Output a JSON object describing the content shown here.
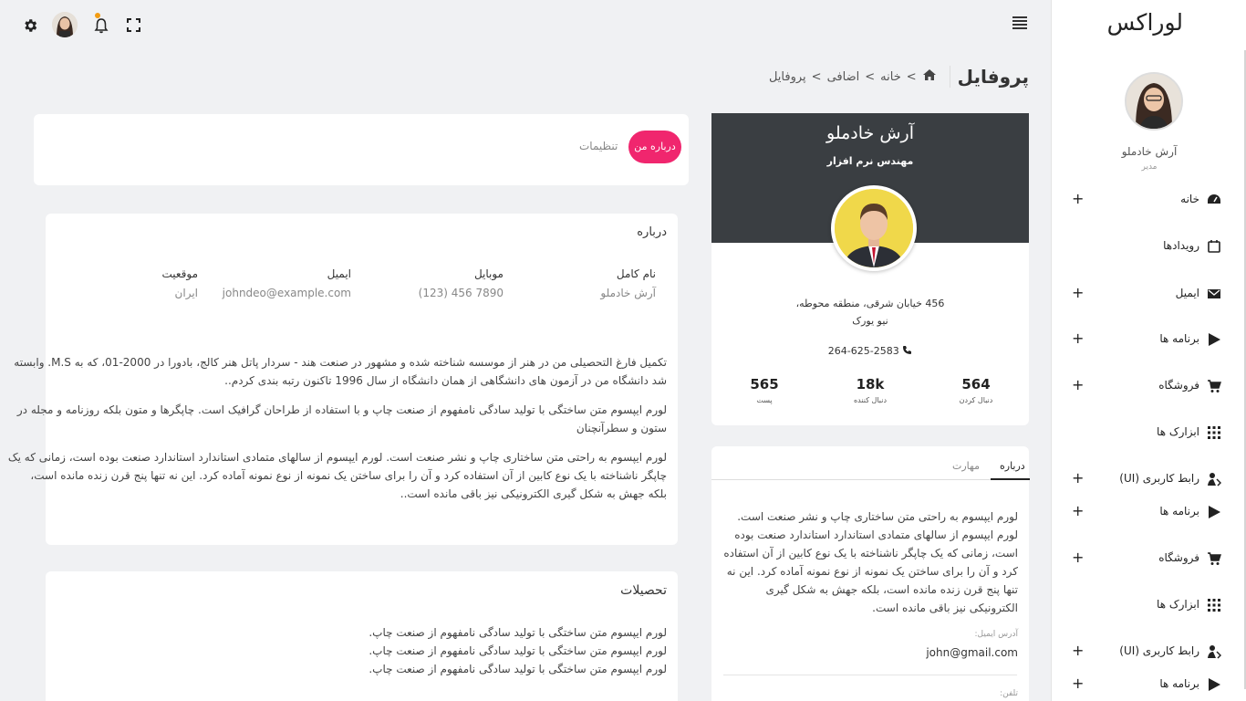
{
  "sidebar": {
    "brand": "لوراکس",
    "user_name": "آرش خادملو",
    "user_role": "مدیر",
    "items": [
      {
        "label": "خانه",
        "icon": "dashboard-icon",
        "plus": "+"
      },
      {
        "label": "رویدادها",
        "icon": "calendar-icon",
        "plus": ""
      },
      {
        "label": "ایمیل",
        "icon": "email-icon",
        "plus": "+"
      },
      {
        "label": "برنامه ها",
        "icon": "apps-icon",
        "plus": "+"
      },
      {
        "label": "فروشگاه",
        "icon": "cart-icon",
        "plus": "+"
      },
      {
        "label": "ابزارک ها",
        "icon": "widgets-icon",
        "plus": ""
      },
      {
        "label": "رابط کاربری (UI)",
        "icon": "ui-icon",
        "plus": "+"
      },
      {
        "label": "برنامه ها",
        "icon": "apps-icon",
        "plus": "+"
      },
      {
        "label": "فروشگاه",
        "icon": "cart-icon",
        "plus": "+"
      },
      {
        "label": "ابزارک ها",
        "icon": "widgets-icon",
        "plus": ""
      },
      {
        "label": "رابط کاربری (UI)",
        "icon": "ui-icon",
        "plus": "+"
      },
      {
        "label": "برنامه ها",
        "icon": "apps-icon",
        "plus": "+"
      }
    ]
  },
  "header": {
    "page_title": "پروفایل",
    "breadcrumb": [
      "خانه",
      "اضافی",
      "پروفایل"
    ],
    "sep": ">"
  },
  "profile": {
    "name": "آرش خادملو",
    "job": "مهندس نرم افزار",
    "address_line1": "456 خیابان شرقی، منطقه محوطه،",
    "address_line2": "نیو یورک",
    "phone": "264-625-2583",
    "stats": [
      {
        "num": "564",
        "label": "دنبال کردن"
      },
      {
        "num": "18k",
        "label": "دنبال کننده"
      },
      {
        "num": "565",
        "label": "پست"
      }
    ]
  },
  "side_tabs": {
    "tab_about": "درباره",
    "tab_skills": "مهارت",
    "about_text": "لورم ایپسوم به راحتی متن ساختاری چاپ و نشر صنعت است. لورم ایپسوم از سالهای متمادی استاندارد استاندارد صنعت بوده است، زمانی که یک چاپگر ناشناخته با یک نوع کابین از آن استفاده کرد و آن را برای ساختن یک نمونه از نوع نمونه آماده کرد. این نه تنها پنج قرن زنده مانده است، بلکه جهش به شکل گیری الکترونیکی نیز باقی مانده است.",
    "email_label": "آدرس ایمیل:",
    "email_value": "john@gmail.com",
    "phone_label": "تلفن:"
  },
  "main_tabs": {
    "about_me": "درباره من",
    "settings": "تنظیمات"
  },
  "about_card": {
    "title": "درباره",
    "fields": [
      {
        "label": "نام کامل",
        "value": "آرش خادملو"
      },
      {
        "label": "موبایل",
        "value": "(123) 456 7890"
      },
      {
        "label": "ایمیل",
        "value": "johndeo@example.com"
      },
      {
        "label": "موقعیت",
        "value": "ایران"
      }
    ],
    "para1_l1": "تکمیل فارغ التحصیلی من در هنر از موسسه شناخته شده و مشهور در صنعت هند - سردار پاتل هنر کالج، بادورا در 2000-01، که به M.S. وابسته",
    "para1_l2": "شد دانشگاه من در آزمون های دانشگاهی از همان دانشگاه از سال 1996 تاکنون رتبه بندی کردم..",
    "para2_l1": "لورم ایپسوم متن ساختگی با تولید سادگی نامفهوم از صنعت چاپ و با استفاده از طراحان گرافیک است. چاپگرها و متون بلکه روزنامه و مجله در",
    "para2_l2": "ستون و سطرآنچنان",
    "para3_l1": "لورم ایپسوم به راحتی متن ساختاری چاپ و نشر صنعت است. لورم ایپسوم از سالهای متمادی استاندارد استاندارد صنعت بوده است، زمانی که یک",
    "para3_l2": "چاپگر ناشناخته با یک نوع کابین از آن استفاده کرد و آن را برای ساختن یک نمونه از نوع نمونه آماده کرد. این نه تنها پنج قرن زنده مانده است،",
    "para3_l3": "بلکه جهش به شکل گیری الکترونیکی نیز باقی مانده است.."
  },
  "education_card": {
    "title": "تحصیلات",
    "lines": [
      "لورم ایپسوم متن ساختگی با تولید سادگی نامفهوم از صنعت چاپ.",
      "لورم ایپسوم متن ساختگی با تولید سادگی نامفهوم از صنعت چاپ.",
      "لورم ایپسوم متن ساختگی با تولید سادگی نامفهوم از صنعت چاپ."
    ]
  },
  "colors": {
    "accent": "#f0266e",
    "dark_header": "#3a3e42",
    "notif_dot": "#f39c12"
  }
}
